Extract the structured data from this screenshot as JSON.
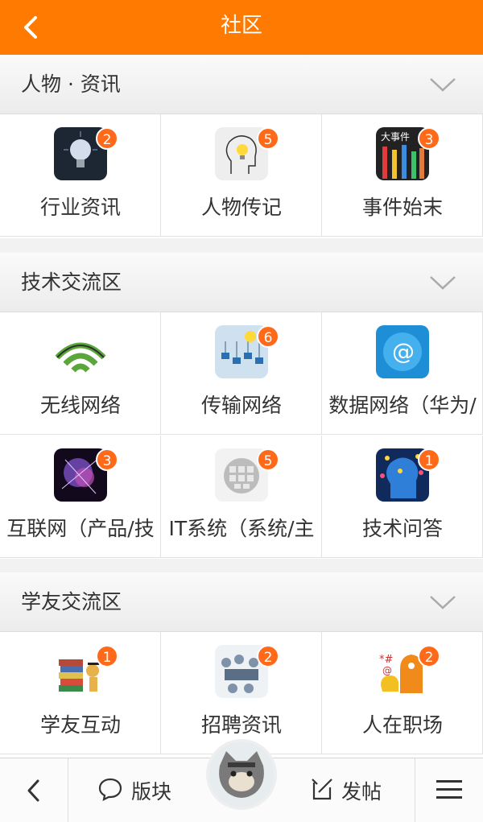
{
  "header": {
    "title": "社区",
    "back_icon": "chevron-left-icon"
  },
  "sections": [
    {
      "title": "人物 · 资讯",
      "items": [
        {
          "label": "行业资讯",
          "badge": "2",
          "icon": "lightbulb-icon"
        },
        {
          "label": "人物传记",
          "badge": "5",
          "icon": "idea-head-icon"
        },
        {
          "label": "事件始末",
          "badge": "3",
          "icon": "big-event-icon"
        }
      ]
    },
    {
      "title": "技术交流区",
      "items": [
        {
          "label": "无线网络",
          "badge": "",
          "icon": "wireless-icon"
        },
        {
          "label": "传输网络",
          "badge": "6",
          "icon": "transmission-icon"
        },
        {
          "label": "数据网络（华为/",
          "badge": "",
          "icon": "at-globe-icon"
        },
        {
          "label": "互联网（产品/技",
          "badge": "3",
          "icon": "internet-brain-icon"
        },
        {
          "label": "IT系统（系统/主",
          "badge": "5",
          "icon": "it-sphere-icon"
        },
        {
          "label": "技术问答",
          "badge": "1",
          "icon": "qa-head-icon"
        }
      ]
    },
    {
      "title": "学友交流区",
      "items": [
        {
          "label": "学友互动",
          "badge": "1",
          "icon": "books-icon"
        },
        {
          "label": "招聘资讯",
          "badge": "2",
          "icon": "meeting-icon"
        },
        {
          "label": "人在职场",
          "badge": "2",
          "icon": "workplace-icon"
        }
      ]
    }
  ],
  "bottom_bar": {
    "back_icon": "chevron-left-icon",
    "board_label": "版块",
    "board_icon": "chat-bubble-icon",
    "post_label": "发帖",
    "post_icon": "compose-icon",
    "menu_icon": "hamburger-menu-icon",
    "avatar_icon": "avatar"
  },
  "colors": {
    "primary": "#ff7a00",
    "badge": "#ff6a1a"
  }
}
